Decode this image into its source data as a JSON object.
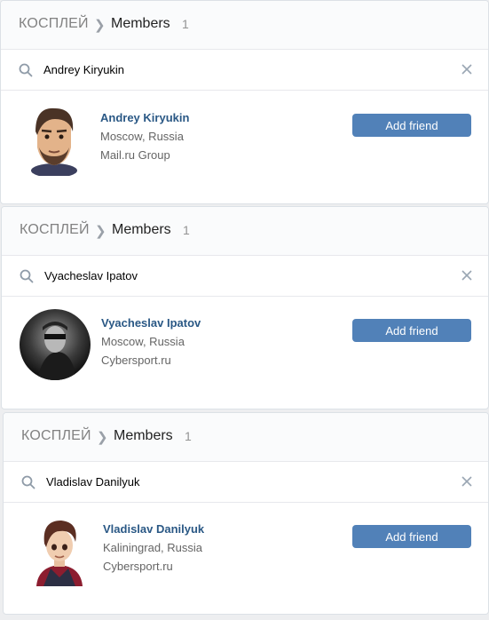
{
  "colors": {
    "accent": "#5181b8",
    "link": "#2a5885",
    "background": "#edeef0",
    "header_bg": "#fafbfc"
  },
  "cards": [
    {
      "breadcrumb": {
        "group": "КОСПЛЕЙ",
        "section": "Members",
        "count": "1"
      },
      "search": {
        "value": "Andrey Kiryukin",
        "icon": "search-icon",
        "clear_icon": "close-icon"
      },
      "person": {
        "name": "Andrey Kiryukin",
        "city": "Moscow, Russia",
        "work": "Mail.ru Group"
      },
      "button_label": "Add friend"
    },
    {
      "breadcrumb": {
        "group": "КОСПЛЕЙ",
        "section": "Members",
        "count": "1"
      },
      "search": {
        "value": "Vyacheslav Ipatov",
        "icon": "search-icon",
        "clear_icon": "close-icon"
      },
      "person": {
        "name": "Vyacheslav Ipatov",
        "city": "Moscow, Russia",
        "work": "Cybersport.ru"
      },
      "button_label": "Add friend"
    },
    {
      "breadcrumb": {
        "group": "КОСПЛЕЙ",
        "section": "Members",
        "count": "1"
      },
      "search": {
        "value": "Vladislav Danilyuk",
        "icon": "search-icon",
        "clear_icon": "close-icon"
      },
      "person": {
        "name": "Vladislav Danilyuk",
        "city": "Kaliningrad, Russia",
        "work": "Cybersport.ru"
      },
      "button_label": "Add friend"
    }
  ]
}
